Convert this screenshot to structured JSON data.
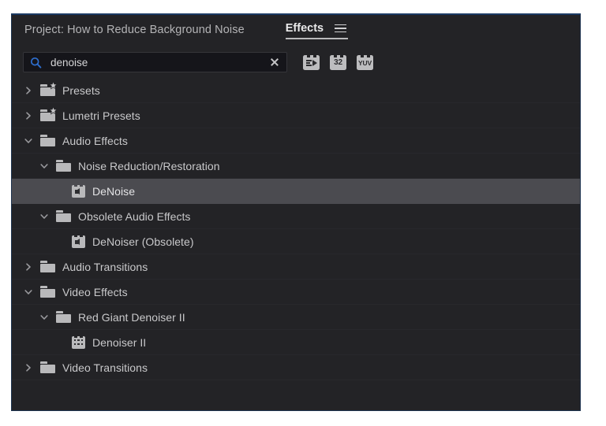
{
  "panel": {
    "name": "effects-panel",
    "accent_border_color": "#1b3a63",
    "background_color": "#232326",
    "selection_color": "#4b4b50"
  },
  "tabs": {
    "project_tab_label": "Project: How to Reduce Background Noise",
    "effects_tab_label": "Effects",
    "menu_icon": "hamburger-menu-icon",
    "active_tab": "Effects"
  },
  "search": {
    "icon": "search-magnifier-icon",
    "icon_color": "#2e6fd0",
    "value": "denoise",
    "placeholder": "",
    "clear_icon": "close-x-icon",
    "filters": [
      {
        "name": "accelerated-effects-filter",
        "label": "",
        "icon": "accelerated-effect-icon"
      },
      {
        "name": "32-bit-color-filter",
        "label": "32",
        "icon": "32-bit-color-icon"
      },
      {
        "name": "yuv-color-filter",
        "label": "YUV",
        "icon": "yuv-color-icon"
      }
    ]
  },
  "tree": {
    "rows": [
      {
        "label": "Presets",
        "indent": 0,
        "twisty": "collapsed",
        "icon": "preset-folder-icon",
        "selected": false
      },
      {
        "label": "Lumetri Presets",
        "indent": 0,
        "twisty": "collapsed",
        "icon": "preset-folder-icon",
        "selected": false
      },
      {
        "label": "Audio Effects",
        "indent": 0,
        "twisty": "expanded",
        "icon": "folder-icon",
        "selected": false
      },
      {
        "label": "Noise Reduction/Restoration",
        "indent": 1,
        "twisty": "expanded",
        "icon": "folder-icon",
        "selected": false
      },
      {
        "label": "DeNoise",
        "indent": 2,
        "twisty": "none",
        "icon": "audio-effect-icon",
        "selected": true
      },
      {
        "label": "Obsolete Audio Effects",
        "indent": 1,
        "twisty": "expanded",
        "icon": "folder-icon",
        "selected": false
      },
      {
        "label": "DeNoiser (Obsolete)",
        "indent": 2,
        "twisty": "none",
        "icon": "audio-effect-icon",
        "selected": false
      },
      {
        "label": "Audio Transitions",
        "indent": 0,
        "twisty": "collapsed",
        "icon": "folder-icon",
        "selected": false
      },
      {
        "label": "Video Effects",
        "indent": 0,
        "twisty": "expanded",
        "icon": "folder-icon",
        "selected": false
      },
      {
        "label": "Red Giant Denoiser II",
        "indent": 1,
        "twisty": "expanded",
        "icon": "folder-icon",
        "selected": false
      },
      {
        "label": "Denoiser II",
        "indent": 2,
        "twisty": "none",
        "icon": "video-effect-icon",
        "selected": false
      },
      {
        "label": "Video Transitions",
        "indent": 0,
        "twisty": "collapsed",
        "icon": "folder-icon",
        "selected": false
      }
    ]
  }
}
